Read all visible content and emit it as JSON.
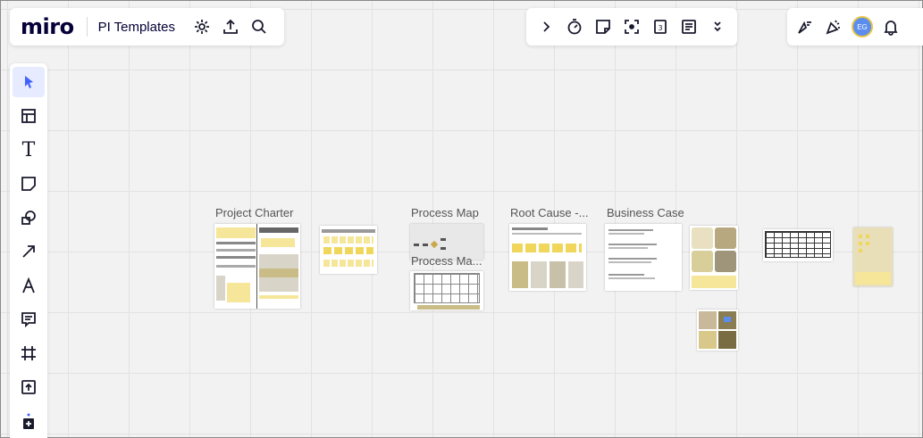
{
  "app": {
    "logo": "miro",
    "board_name": "PI Templates"
  },
  "top_toolbar_left": {
    "icons": [
      "settings-icon",
      "upload-icon",
      "search-icon"
    ]
  },
  "top_toolbar_mid": {
    "icons": [
      "chevron-right-icon",
      "timer-icon",
      "note-icon",
      "focus-icon",
      "calendar-number-icon",
      "notes-icon",
      "chevrons-down-icon"
    ],
    "calendar_number": "3"
  },
  "top_toolbar_right": {
    "icons": [
      "reactions-icon",
      "celebrate-icon",
      "avatar",
      "bell-icon"
    ],
    "avatar_initials": "EG"
  },
  "left_toolbar": {
    "tools": [
      "select-tool-icon",
      "templates-icon",
      "text-tool-icon",
      "sticky-note-icon",
      "shapes-icon",
      "arrow-line-icon",
      "pen-icon",
      "comment-icon",
      "frame-icon",
      "upload-to-board-icon",
      "more-tools-icon"
    ],
    "text_tool_glyph": "T"
  },
  "frames": [
    {
      "title": "Project Charter"
    },
    {
      "title": "Process Map"
    },
    {
      "title": "Process Ma..."
    },
    {
      "title": "Root Cause -..."
    },
    {
      "title": "Business Case"
    }
  ]
}
